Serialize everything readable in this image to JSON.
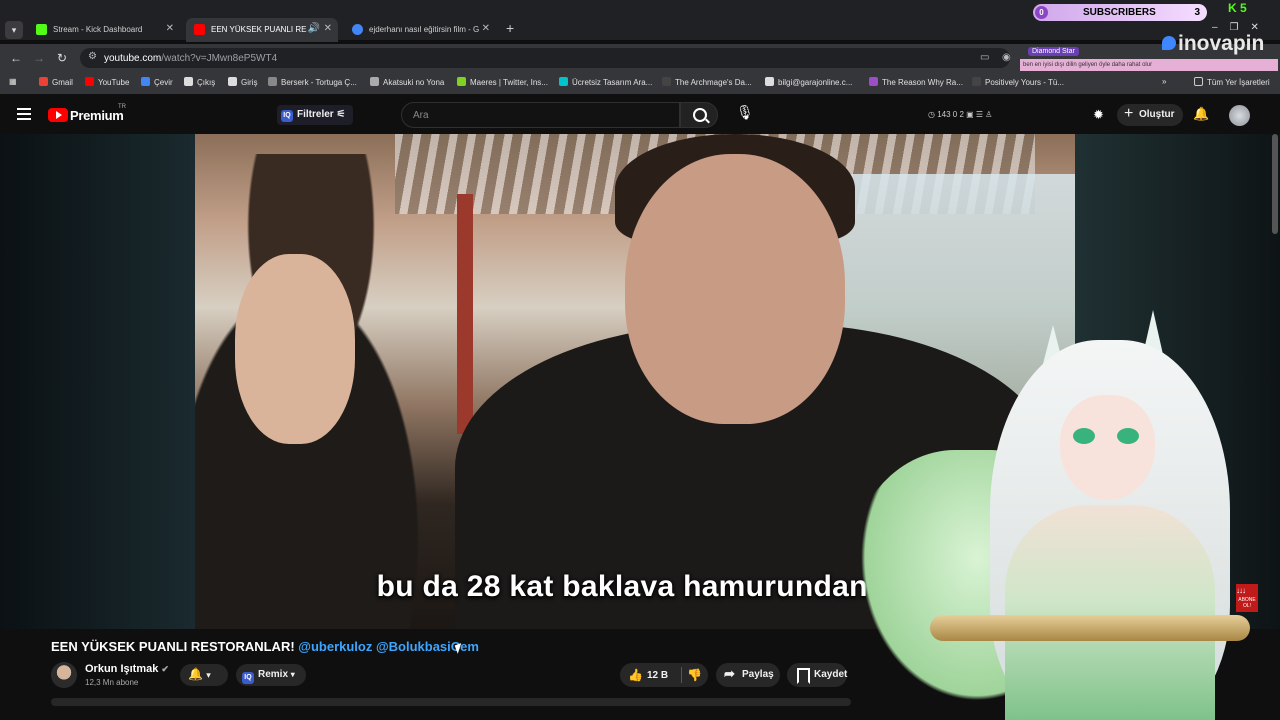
{
  "browser": {
    "tabs": [
      {
        "title": "Stream - Kick Dashboard",
        "favicon_color": "#53fc18",
        "active": false
      },
      {
        "title": "EEN YÜKSEK PUANLI RESTORA",
        "favicon_color": "#ff0000",
        "active": true
      },
      {
        "title": "ejderhanı nasıl eğitirsin film - G",
        "favicon_color": "#4285f4",
        "active": false
      }
    ],
    "url_host": "youtube.com",
    "url_path": "/watch?v=JMwn8eP5WT4",
    "bookmarks": [
      {
        "label": "Gmail",
        "color": "#ea4335"
      },
      {
        "label": "YouTube",
        "color": "#ff0000"
      },
      {
        "label": "Çevir",
        "color": "#4285f4"
      },
      {
        "label": "Çıkış",
        "color": "#dddddd"
      },
      {
        "label": "Giriş",
        "color": "#dddddd"
      },
      {
        "label": "Berserk - Tortuga Ç...",
        "color": "#888888"
      },
      {
        "label": "Akatsuki no Yona",
        "color": "#aaaaaa"
      },
      {
        "label": "Maeres | Twitter, Ins...",
        "color": "#7ed321"
      },
      {
        "label": "Ücretsiz Tasarım Ara...",
        "color": "#00c4cc"
      },
      {
        "label": "The Archmage's Da...",
        "color": "#444444"
      },
      {
        "label": "bilgi@garajonline.c...",
        "color": "#dddddd"
      },
      {
        "label": "The Reason Why Ra...",
        "color": "#9b4dca"
      },
      {
        "label": "Positively Yours - Tü...",
        "color": "#444444"
      }
    ],
    "all_bookmarks": "Tüm Yer İşaretleri"
  },
  "stream_overlay": {
    "subs_label": "SUBSCRIBERS",
    "subs_left": "0",
    "subs_count": "3",
    "kick_count": "5",
    "sponsor": "inovapin",
    "sponsor_tag": "Diamond Star",
    "ticker": "ben en iyisi dışı dilin geliyen öyle daha rahat olur"
  },
  "youtube": {
    "brand": "Premium",
    "region": "TR",
    "filters": "Filtreler",
    "search_placeholder": "Ara",
    "stats": "143   0   2",
    "create": "Oluştur",
    "subtitle": "bu da 28 kat baklava hamurundan y",
    "video_title": "EEN YÜKSEK PUANLI RESTORANLAR!",
    "mentions": "@uberkuloz @BolukbasiCem",
    "channel_name": "Orkun Işıtmak",
    "channel_subs": "12,3 Mn abone",
    "remix": "Remix",
    "likes": "12 B",
    "share": "Paylaş",
    "save": "Kaydet",
    "abone_badge": "ABONE OL!"
  }
}
